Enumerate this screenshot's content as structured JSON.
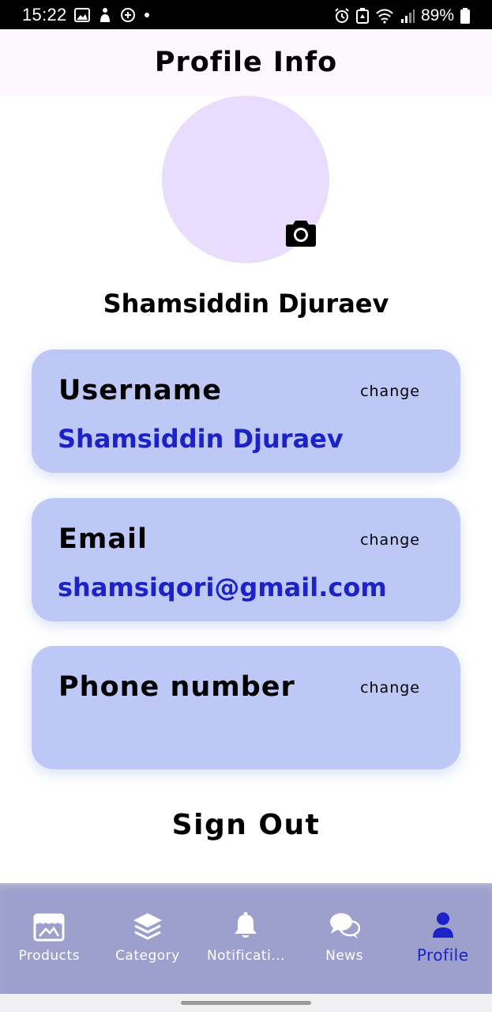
{
  "status_bar": {
    "time": "15:22",
    "battery": "89%",
    "left_icons": [
      "image-icon",
      "accessibility-icon",
      "message-plus-icon",
      "dot-icon"
    ],
    "right_icons": [
      "alarm-icon",
      "recycle-icon",
      "wifi-icon",
      "signal-icon",
      "battery-icon"
    ]
  },
  "header": {
    "title": "Profile Info"
  },
  "profile": {
    "name": "Shamsiddin Djuraev",
    "avatar_color": "#eadcfd",
    "camera_icon": "camera-icon"
  },
  "cards": {
    "username": {
      "label": "Username",
      "change": "change",
      "value": "Shamsiddin Djuraev"
    },
    "email": {
      "label": "Email",
      "change": "change",
      "value": "shamsiqori@gmail.com"
    },
    "phone": {
      "label": "Phone number",
      "change": "change",
      "value": ""
    }
  },
  "sign_out": "Sign Out",
  "bottom_nav": {
    "items": [
      {
        "label": "Products",
        "icon": "store-icon",
        "active": false
      },
      {
        "label": "Category",
        "icon": "layers-icon",
        "active": false
      },
      {
        "label": "Notificati...",
        "icon": "bell-icon",
        "active": false
      },
      {
        "label": "News",
        "icon": "chat-bubbles-icon",
        "active": false
      },
      {
        "label": "Profile",
        "icon": "person-icon",
        "active": true
      }
    ]
  },
  "colors": {
    "header_bg": "#fdf7fe",
    "card_bg": "#bec8f6",
    "value_text": "#1b22c8",
    "nav_bg": "#9d9fcd",
    "nav_active": "#1b22c8"
  }
}
